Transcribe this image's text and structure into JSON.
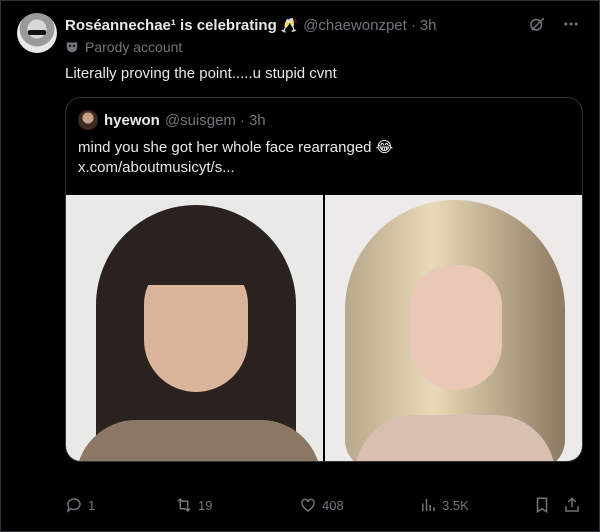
{
  "post": {
    "display_name": "Roséannechae¹ is celebrating",
    "celebrate_emoji": "🥂",
    "handle": "@chaewonzpet",
    "separator": "·",
    "time": "3h",
    "parody_label": "Parody account",
    "text": "Literally proving the point.....u stupid cvnt"
  },
  "quote": {
    "display_name": "hyewon",
    "handle": "@suisgem",
    "separator": "·",
    "time": "3h",
    "text_line1": "mind you she got her whole face rearranged 😂",
    "text_line2": "x.com/aboutmusicyt/s..."
  },
  "actions": {
    "replies": "1",
    "reposts": "19",
    "likes": "408",
    "views": "3.5K"
  },
  "colors": {
    "background": "#000000",
    "text": "#e7e9ea",
    "muted": "#71767b",
    "border": "#2f3336"
  }
}
